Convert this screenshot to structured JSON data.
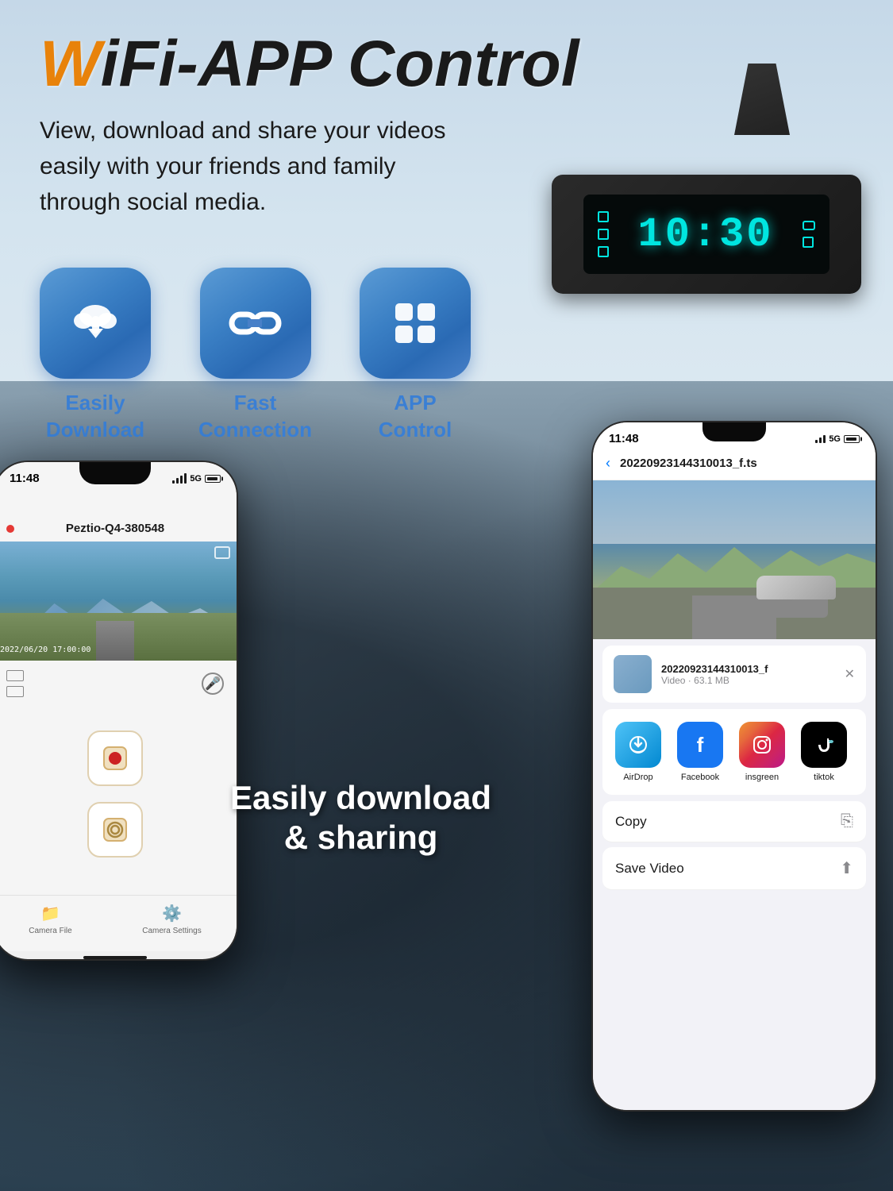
{
  "title": "WiFi-APP Control",
  "title_prefix_colored": "Wi",
  "title_rest": "Fi-APP Control",
  "subtitle": "View, download and share your videos easily with your friends and family through social media.",
  "features": [
    {
      "id": "download",
      "label": "Easily\nDownload",
      "label_line1": "Easily",
      "label_line2": "Download"
    },
    {
      "id": "connection",
      "label": "Fast\nConnection",
      "label_line1": "Fast",
      "label_line2": "Connection"
    },
    {
      "id": "control",
      "label": "APP\nControl",
      "label_line1": "APP",
      "label_line2": "Control"
    }
  ],
  "device": {
    "time": "10:30"
  },
  "phone_left": {
    "status_time": "11:48",
    "app_name": "Peztio-Q4-380548",
    "video_timestamp": "2022/06/20  17:00:00",
    "btn_record": "🔴",
    "btn_camera": "📷",
    "nav_camera_file": "Camera File",
    "nav_settings": "Camera Settings"
  },
  "phone_right": {
    "status_time": "11:48",
    "filename": "20220923144310013_f.ts",
    "share_file_name": "20220923144310013_f",
    "share_file_meta": "Video · 63.1 MB",
    "apps": [
      {
        "id": "airdrop",
        "label": "AirDrop"
      },
      {
        "id": "facebook",
        "label": "Facebook"
      },
      {
        "id": "instagram",
        "label": "insgreen"
      },
      {
        "id": "tiktok",
        "label": "tiktok"
      }
    ],
    "actions": [
      {
        "id": "copy",
        "label": "Copy"
      },
      {
        "id": "save-video",
        "label": "Save Video"
      }
    ]
  },
  "overlay_text_line1": "Easily download",
  "overlay_text_line2": "& sharing",
  "colors": {
    "title_accent": "#e8820a",
    "feature_label": "#3a7fd4",
    "screen_cyan": "#00e5e0"
  }
}
